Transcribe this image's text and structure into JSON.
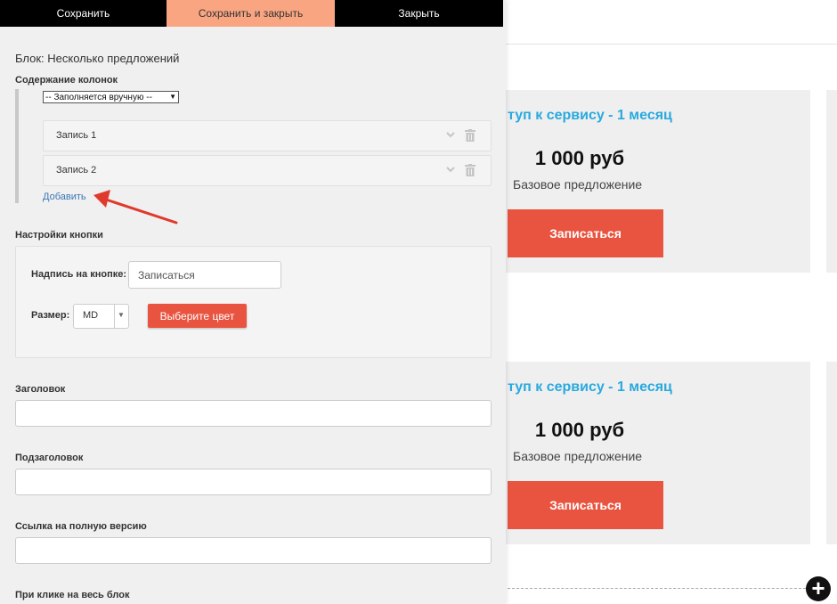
{
  "toolbar": {
    "save": "Сохранить",
    "save_close": "Сохранить и закрыть",
    "close": "Закрыть"
  },
  "editor": {
    "block_label": "Блок: Несколько предложений",
    "columns_label": "Содержание колонок",
    "fill_select": "-- Заполняется вручную --",
    "records": [
      {
        "label": "Запись 1"
      },
      {
        "label": "Запись 2"
      }
    ],
    "add_link": "Добавить",
    "button_settings_label": "Настройки кнопки",
    "button_caption_label": "Надпись на кнопке:",
    "button_caption_value": "Записаться",
    "size_label": "Размер:",
    "size_value": "MD",
    "choose_color": "Выберите цвет",
    "heading_label": "Заголовок",
    "subheading_label": "Подзаголовок",
    "full_link_label": "Ссылка на полную версию",
    "click_label": "При клике на весь блок"
  },
  "preview": {
    "cards": [
      {
        "title": "туп к сервису - 1 месяц",
        "price": "1 000 руб",
        "subtitle": "Базовое предложение",
        "button": "Записаться"
      },
      {
        "title": "туп к сервису - 1 месяц",
        "price": "1 000 руб",
        "subtitle": "Базовое предложение",
        "button": "Записаться"
      }
    ],
    "add_icon": "plus-icon"
  },
  "colors": {
    "accent": "#e85440",
    "title_blue": "#29a9df",
    "toolbar_active": "#f9a582",
    "toolbar_bg": "#000000",
    "link": "#3a77b7"
  }
}
